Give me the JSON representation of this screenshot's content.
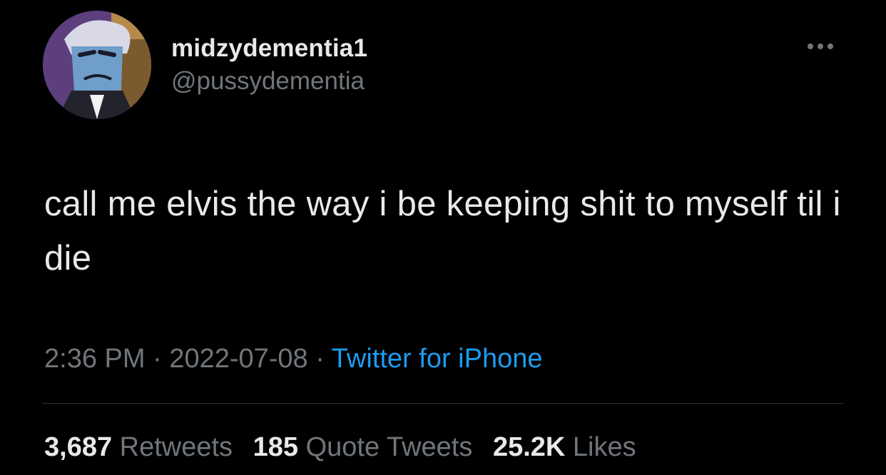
{
  "author": {
    "display_name": "midzydementia1",
    "handle": "@pussydementia"
  },
  "more_icon": "more-horizontal-icon",
  "tweet": {
    "text": "call me elvis the way i be keeping shit to myself til i die"
  },
  "meta": {
    "time": "2:36 PM",
    "separator": " · ",
    "date": "2022-07-08",
    "source": "Twitter for iPhone"
  },
  "stats": {
    "retweets_count": "3,687",
    "retweets_label": "Retweets",
    "quotes_count": "185",
    "quotes_label": "Quote Tweets",
    "likes_count": "25.2K",
    "likes_label": "Likes"
  },
  "colors": {
    "background": "#000000",
    "text_primary": "#e7e9ea",
    "text_secondary": "#71767b",
    "link": "#1d9bf0",
    "divider": "#2f3336"
  }
}
